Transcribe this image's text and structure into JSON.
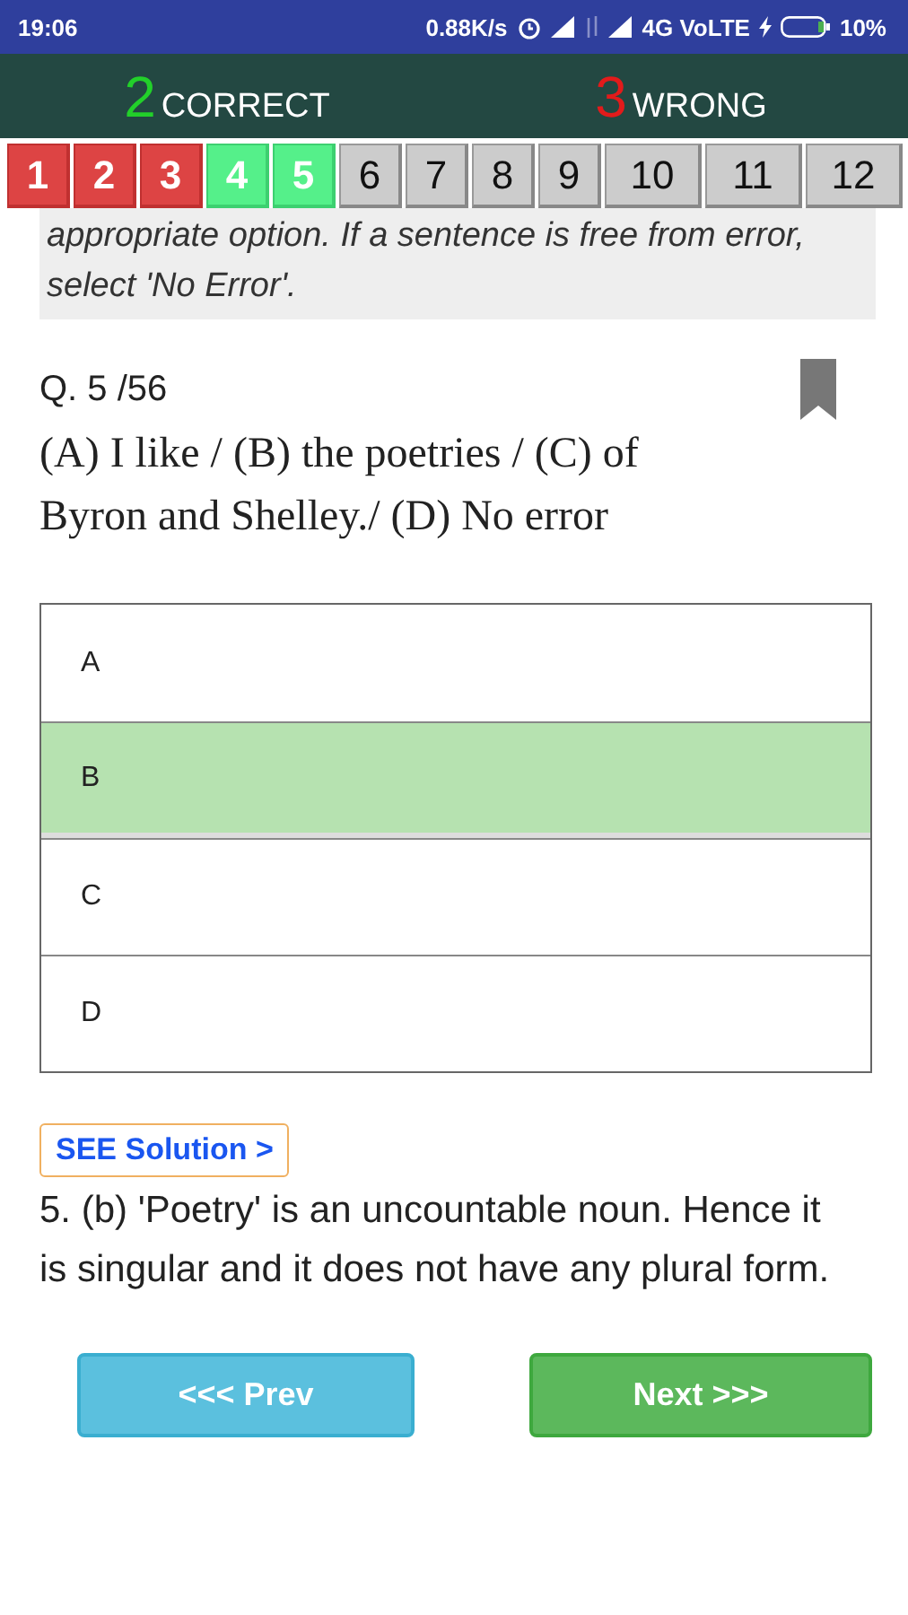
{
  "status_bar": {
    "time": "19:06",
    "speed": "0.88K/s",
    "network": "4G VoLTE",
    "battery": "10%"
  },
  "score": {
    "correct_count": "2",
    "correct_label": "CORRECT",
    "wrong_count": "3",
    "wrong_label": "WRONG"
  },
  "question_strip": [
    {
      "label": "1",
      "kind": "wrong"
    },
    {
      "label": "2",
      "kind": "wrong"
    },
    {
      "label": "3",
      "kind": "wrong"
    },
    {
      "label": "4",
      "kind": "correct"
    },
    {
      "label": "5",
      "kind": "correct"
    },
    {
      "label": "6",
      "kind": "unanswered"
    },
    {
      "label": "7",
      "kind": "unanswered"
    },
    {
      "label": "8",
      "kind": "unanswered"
    },
    {
      "label": "9",
      "kind": "unanswered"
    },
    {
      "label": "10",
      "kind": "unanswered"
    },
    {
      "label": "11",
      "kind": "unanswered"
    },
    {
      "label": "12",
      "kind": "unanswered"
    }
  ],
  "instruction": "appropriate option. If a sentence is free from error, select 'No Error'.",
  "question_number": "Q. 5 /56",
  "bookmarked": true,
  "question": "(A) I like / (B) the poetries / (C) of Byron and Shelley./ (D) No error",
  "options": [
    {
      "label": "A",
      "selected": false
    },
    {
      "label": "B",
      "selected": true
    },
    {
      "label": "C",
      "selected": false
    },
    {
      "label": "D",
      "selected": false
    }
  ],
  "solution_button": "SEE Solution >",
  "solution": "5. (b) 'Poetry' is an uncountable noun. Hence it is singular and it does not have any plural form.",
  "prev_button": "<<< Prev",
  "next_button": "Next >>>"
}
